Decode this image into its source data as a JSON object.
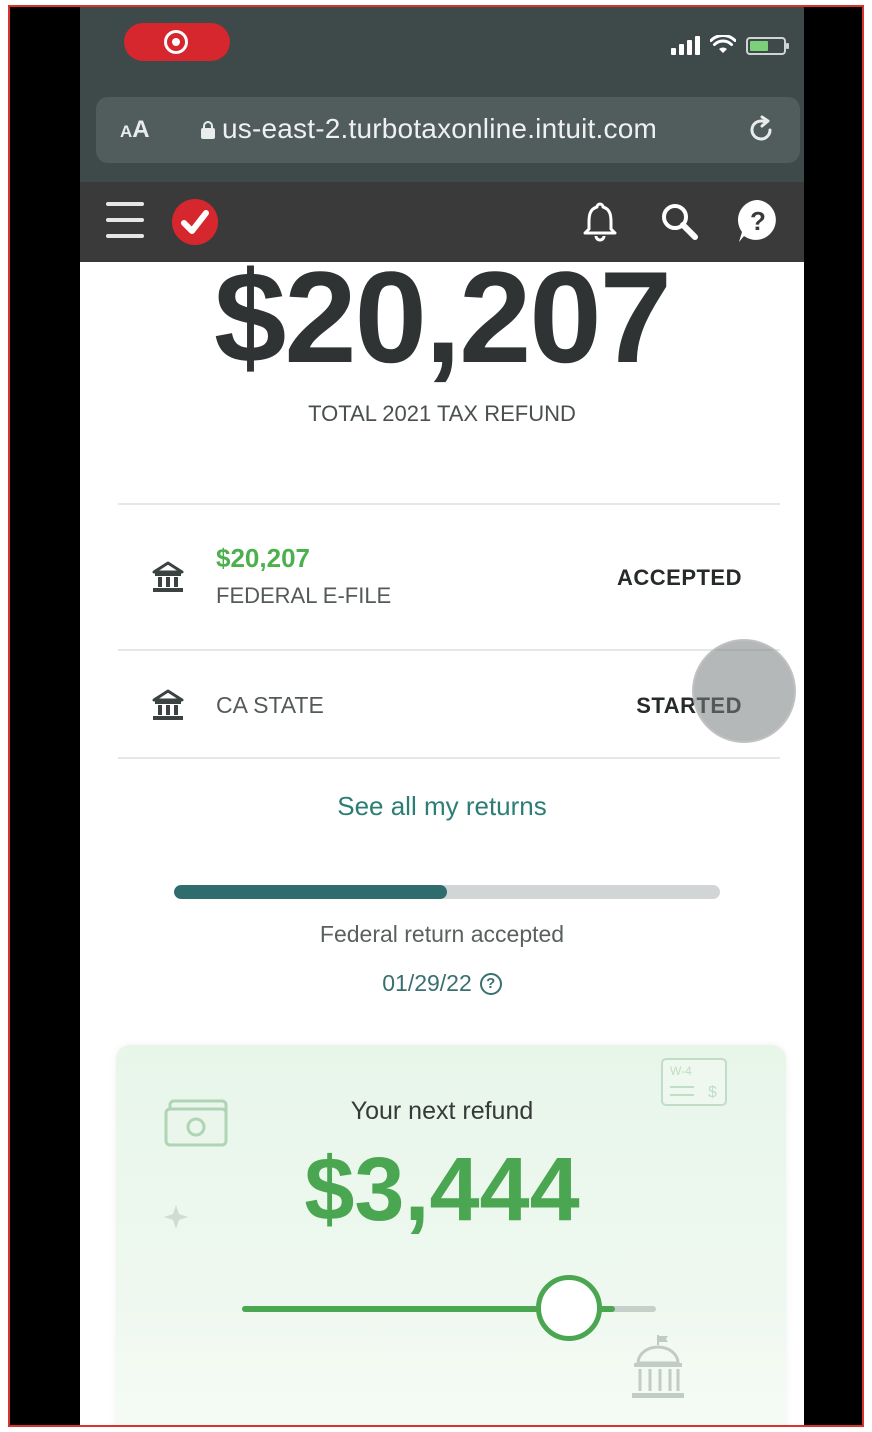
{
  "browser": {
    "aa_label_small": "A",
    "aa_label_big": "A",
    "url": "us-east-2.turbotaxonline.intuit.com"
  },
  "summary": {
    "total_refund": "$20,207",
    "total_label": "TOTAL 2021 TAX REFUND"
  },
  "returns": [
    {
      "amount": "$20,207",
      "label": "FEDERAL E-FILE",
      "status": "ACCEPTED"
    },
    {
      "label": "CA STATE",
      "status": "STARTED"
    }
  ],
  "see_all_link": "See all my returns",
  "progress": {
    "fraction": 0.5,
    "text": "Federal return accepted",
    "date": "01/29/22",
    "help_glyph": "?"
  },
  "next_refund": {
    "title": "Your next refund",
    "amount": "$3,444",
    "slider_fraction": 0.9,
    "w4_label": "W-4",
    "w4_symbol": "$"
  },
  "colors": {
    "accent_green": "#4aa651",
    "teal": "#2e6c6e",
    "brand_red": "#d6262e",
    "header_dark": "#3a3a3a"
  },
  "icons": [
    "record-icon",
    "signal-icon",
    "wifi-icon",
    "battery-icon",
    "lock-icon",
    "reload-icon",
    "menu-icon",
    "turbotax-logo-icon",
    "bell-icon",
    "search-icon",
    "help-icon",
    "bank-icon",
    "question-icon",
    "money-icon",
    "w4-form-icon",
    "capitol-icon"
  ]
}
